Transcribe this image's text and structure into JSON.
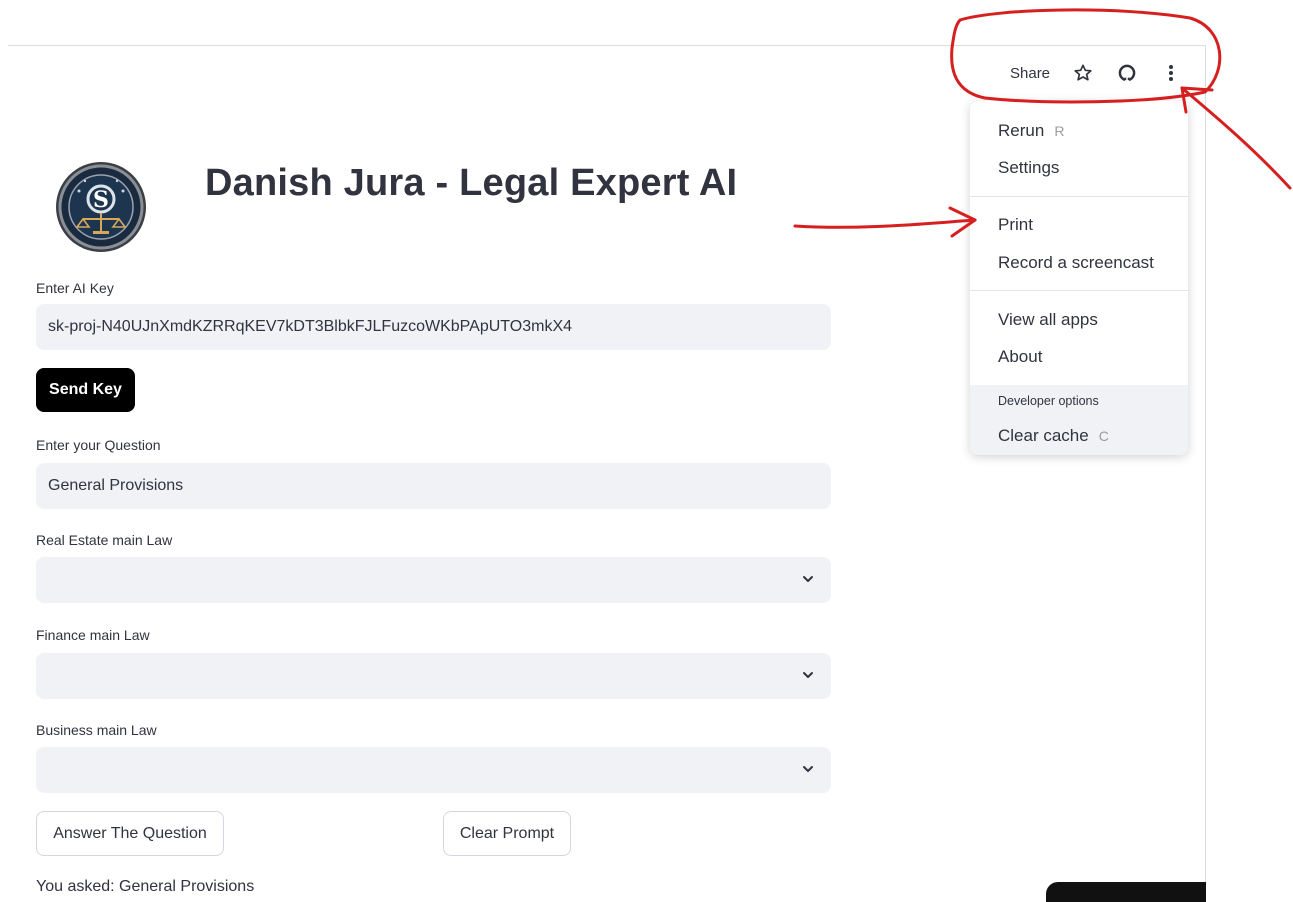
{
  "toolbar": {
    "share_label": "Share"
  },
  "header": {
    "title": "Danish Jura - Legal Expert AI"
  },
  "form": {
    "ai_key_label": "Enter AI Key",
    "ai_key_value": "sk-proj-N40UJnXmdKZRRqKEV7kDT3BlbkFJLFuzcoWKbPApUTO3mkX4",
    "send_key_label": "Send Key",
    "question_label": "Enter your Question",
    "question_value": "General Provisions",
    "real_estate_label": "Real Estate main Law",
    "finance_label": "Finance main Law",
    "business_label": "Business main Law",
    "answer_button": "Answer The Question",
    "clear_button": "Clear Prompt"
  },
  "result": {
    "asked_text": "You asked: General Provisions"
  },
  "menu": {
    "rerun": "Rerun",
    "rerun_key": "R",
    "settings": "Settings",
    "print": "Print",
    "record": "Record a screencast",
    "view_all": "View all apps",
    "about": "About",
    "developer_options": "Developer options",
    "clear_cache": "Clear cache",
    "clear_cache_key": "C"
  },
  "colors": {
    "annotation": "#d61f1f",
    "field_bg": "#f0f2f6",
    "text": "#31333f",
    "button_dark": "#000000"
  },
  "icons": [
    "star-icon",
    "github-icon",
    "kebab-menu-icon",
    "chevron-down-icon",
    "legal-scales-logo"
  ]
}
